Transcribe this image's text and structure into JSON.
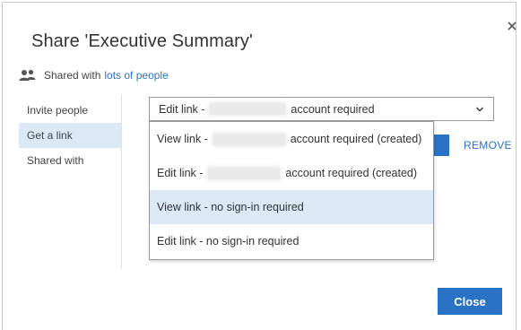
{
  "dialog": {
    "title": "Share 'Executive Summary'",
    "close_icon": "close-icon",
    "shared_with": {
      "icon": "people-icon",
      "prefix": "Shared with",
      "link": "lots of people"
    },
    "nav": [
      {
        "label": "Invite people",
        "active": false
      },
      {
        "label": "Get a link",
        "active": true
      },
      {
        "label": "Shared with",
        "active": false
      }
    ],
    "link_select": {
      "selected_prefix": "Edit link -",
      "selected_suffix": "account required",
      "chevron_icon": "chevron-down-icon"
    },
    "dropdown_options": [
      {
        "prefix": "View link -",
        "suffix": "account required (created)",
        "highlighted": false
      },
      {
        "prefix": "Edit link -",
        "suffix": "account required (created)",
        "highlighted": false
      },
      {
        "label": "View link - no sign-in required",
        "highlighted": true
      },
      {
        "label": "Edit link - no sign-in required",
        "highlighted": false
      }
    ],
    "remove_label": "REMOVE",
    "close_label": "Close",
    "accent_color": "#2a72c6",
    "highlight_color": "#dbe9f6"
  }
}
